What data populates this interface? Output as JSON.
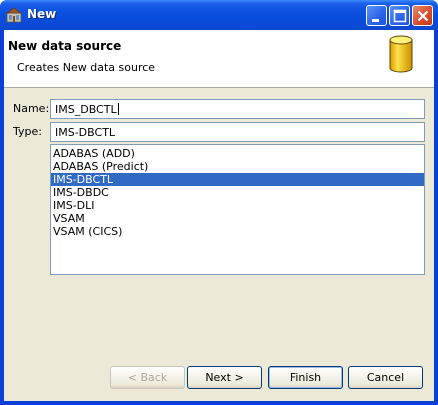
{
  "window": {
    "title": "New"
  },
  "header": {
    "title": "New data source",
    "description": "Creates New data source"
  },
  "form": {
    "name_label": "Name:",
    "name_value": "IMS_DBCTL",
    "type_label": "Type:",
    "type_value": "IMS-DBCTL"
  },
  "type_list": {
    "items": [
      "ADABAS (ADD)",
      "ADABAS (Predict)",
      "IMS-DBCTL",
      "IMS-DBDC",
      "IMS-DLI",
      "VSAM",
      "VSAM (CICS)"
    ],
    "selected": "IMS-DBCTL"
  },
  "buttons": {
    "back": "< Back",
    "next": "Next >",
    "finish": "Finish",
    "cancel": "Cancel"
  },
  "icons": {
    "title": "database-app-icon",
    "header": "database-cylinder-icon"
  },
  "colors": {
    "titlebar": "#0a4ad8",
    "selection": "#316ac5",
    "dialog_bg": "#ece9d8",
    "db_icon": "#f5c400"
  }
}
